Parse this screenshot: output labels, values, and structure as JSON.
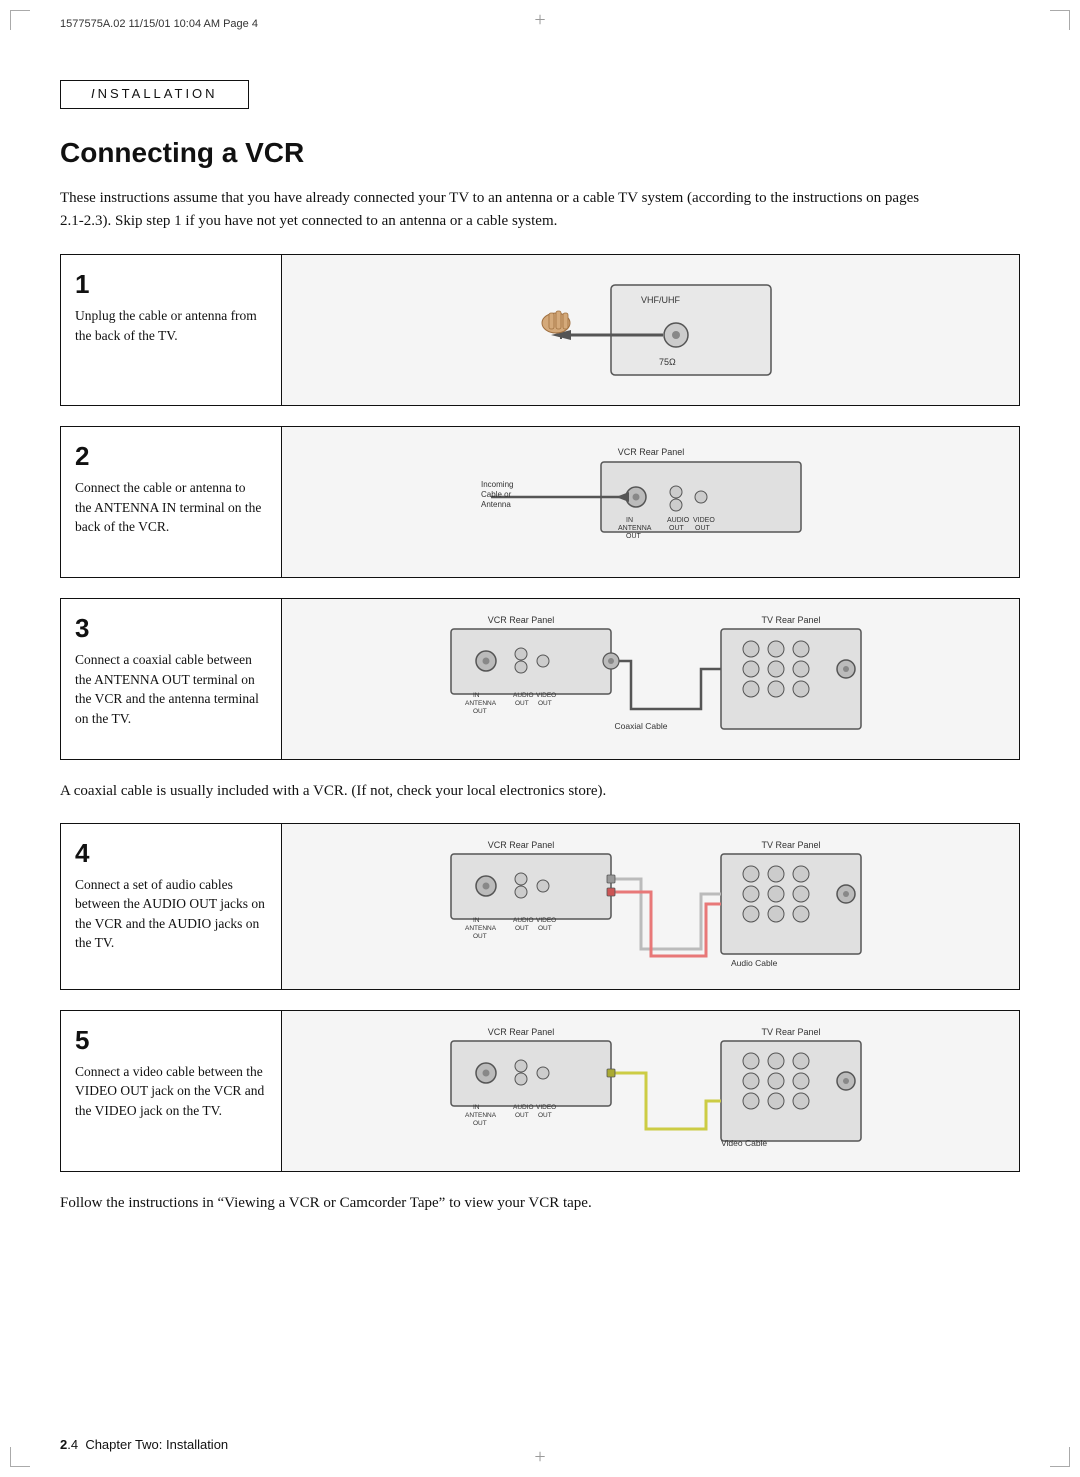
{
  "meta": {
    "print_info": "1577575A.02  11/15/01  10:04 AM  Page 4"
  },
  "header": {
    "label": "Installation",
    "label_display": "NSTALLATION"
  },
  "page_title": "Connecting a VCR",
  "intro": "These instructions assume that you have already connected your TV to an antenna or a cable TV system (according to the instructions on pages 2.1-2.3). Skip step 1 if you have not yet connected to an antenna or a cable system.",
  "steps": [
    {
      "number": "1",
      "text": "Unplug the cable or antenna from the back of the TV.",
      "diagram_label": "Step 1 diagram - unplug cable from TV"
    },
    {
      "number": "2",
      "text": "Connect the cable or antenna to the ANTENNA IN terminal on the back of the VCR.",
      "diagram_label": "Step 2 diagram - VCR Rear Panel",
      "sub_label": "VCR Rear Panel",
      "incoming_label": "Incoming\nCable or\nAntenna"
    },
    {
      "number": "3",
      "text": "Connect a coaxial cable between the ANTENNA OUT terminal on the VCR and the antenna terminal on the TV.",
      "diagram_label": "Step 3 diagram - VCR and TV Rear Panels",
      "vcr_label": "VCR Rear Panel",
      "tv_label": "TV Rear Panel",
      "cable_label": "Coaxial Cable"
    },
    {
      "number": "4",
      "text": "Connect a set of audio cables between the AUDIO OUT jacks on the VCR and the AUDIO jacks on the TV.",
      "diagram_label": "Step 4 diagram - audio cables",
      "vcr_label": "VCR Rear Panel",
      "tv_label": "TV Rear Panel",
      "cable_label": "Audio Cable"
    },
    {
      "number": "5",
      "text": "Connect a video cable between the VIDEO OUT jack on the VCR and the VIDEO jack on the TV.",
      "diagram_label": "Step 5 diagram - video cable",
      "vcr_label": "VCR Rear Panel",
      "tv_label": "TV Rear Panel",
      "cable_label": "Video Cable"
    }
  ],
  "interstitial_text": "A coaxial cable is usually included with a VCR. (If not, check your local electronics store).",
  "follow_up_text": "Follow the instructions in “Viewing a VCR or Camcorder Tape” to view your VCR tape.",
  "footer": {
    "page_ref": "2",
    "page_sub": ".4",
    "chapter_label": "Chapter Two: Installation"
  }
}
